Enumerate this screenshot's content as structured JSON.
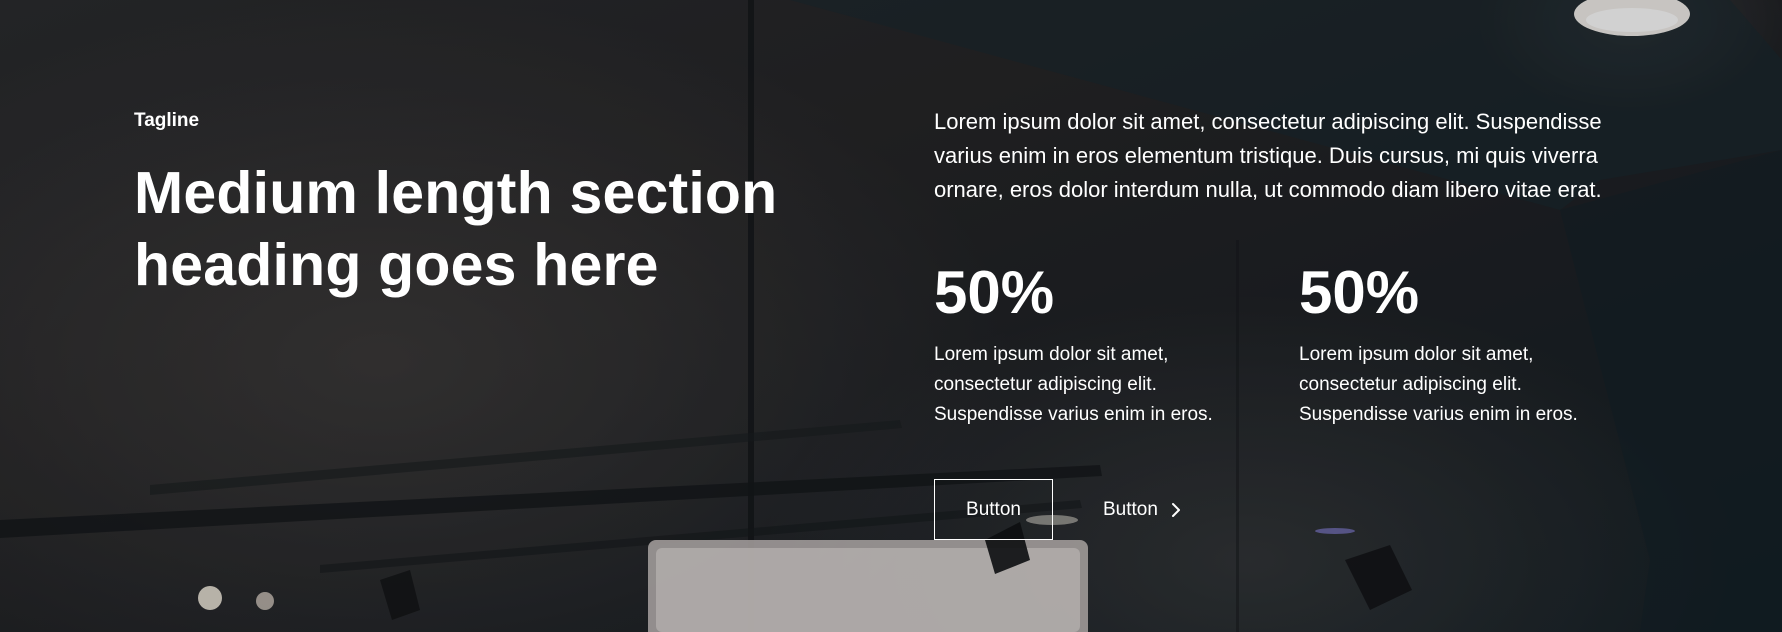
{
  "section": {
    "tagline": "Tagline",
    "heading": "Medium length section heading goes here",
    "intro": "Lorem ipsum dolor sit amet, consectetur adipiscing elit. Suspendisse varius enim in eros elementum tristique. Duis cursus, mi quis viverra ornare, eros dolor interdum nulla, ut commodo diam libero vitae erat."
  },
  "stats": [
    {
      "value": "50%",
      "description": "Lorem ipsum dolor sit amet, consectetur adipiscing elit. Suspendisse varius enim in eros."
    },
    {
      "value": "50%",
      "description": "Lorem ipsum dolor sit amet, consectetur adipiscing elit. Suspendisse varius enim in eros."
    }
  ],
  "buttons": {
    "primary_label": "Button",
    "secondary_label": "Button",
    "secondary_icon": "chevron-right-icon"
  },
  "colors": {
    "text": "#ffffff",
    "background_dark": "#1f2226"
  }
}
